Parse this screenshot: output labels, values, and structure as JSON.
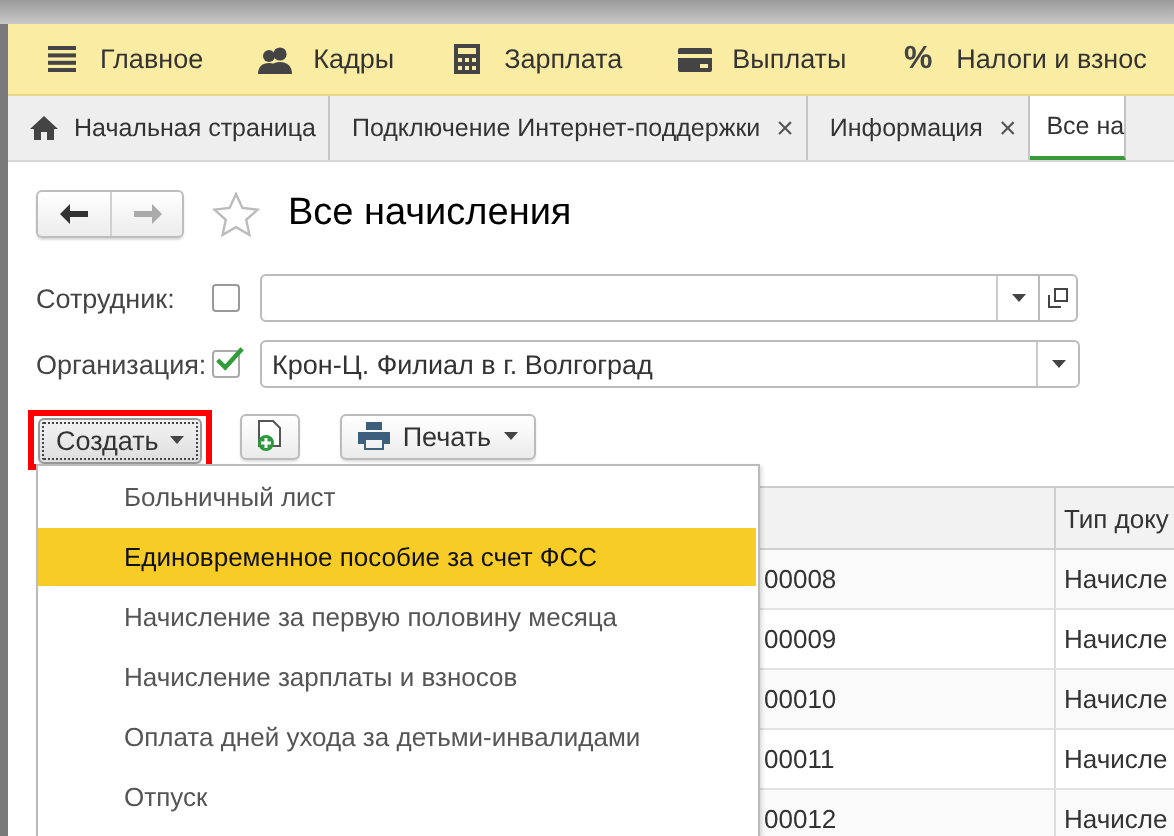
{
  "menubar": [
    {
      "label": "Главное"
    },
    {
      "label": "Кадры"
    },
    {
      "label": "Зарплата"
    },
    {
      "label": "Выплаты"
    },
    {
      "label": "Налоги и взнос",
      "glyph": "%"
    }
  ],
  "tabs": [
    {
      "label": "Начальная страница",
      "selected": false,
      "home": true
    },
    {
      "label": "Подключение Интернет-поддержки",
      "selected": false,
      "close": "×"
    },
    {
      "label": "Информация",
      "selected": false,
      "close": "×"
    },
    {
      "label": "Все на",
      "selected": true
    }
  ],
  "title": "Все начисления",
  "filters": [
    {
      "label": "Сотрудник:",
      "checked": false,
      "open_button": true
    },
    {
      "label": "Организация:",
      "checked": true,
      "value": "Крон-Ц. Филиал в г. Волгоград",
      "open_button": false
    }
  ],
  "toolbar": {
    "create": {
      "label": "Создать",
      "highlighted": true
    },
    "print": {
      "label": "Печать"
    }
  },
  "table": {
    "column_2_header": "Тип доку",
    "rows": [
      {
        "column_1": "00008",
        "column_2": "Начисле"
      },
      {
        "column_1": "00009",
        "column_2": "Начисле"
      },
      {
        "column_1": "00010",
        "column_2": "Начисле"
      },
      {
        "column_1": "00011",
        "column_2": "Начисле"
      },
      {
        "column_1": "00012",
        "column_2": "Начисле"
      }
    ]
  },
  "create_menu": [
    {
      "label": "Больничный лист",
      "selected": false
    },
    {
      "label": "Единовременное пособие за счет ФСС",
      "selected": true
    },
    {
      "label": "Начисление за первую половину месяца",
      "selected": false
    },
    {
      "label": "Начисление зарплаты и взносов",
      "selected": false
    },
    {
      "label": "Оплата дней ухода за детьми-инвалидами",
      "selected": false
    },
    {
      "label": "Отпуск",
      "selected": false
    }
  ]
}
